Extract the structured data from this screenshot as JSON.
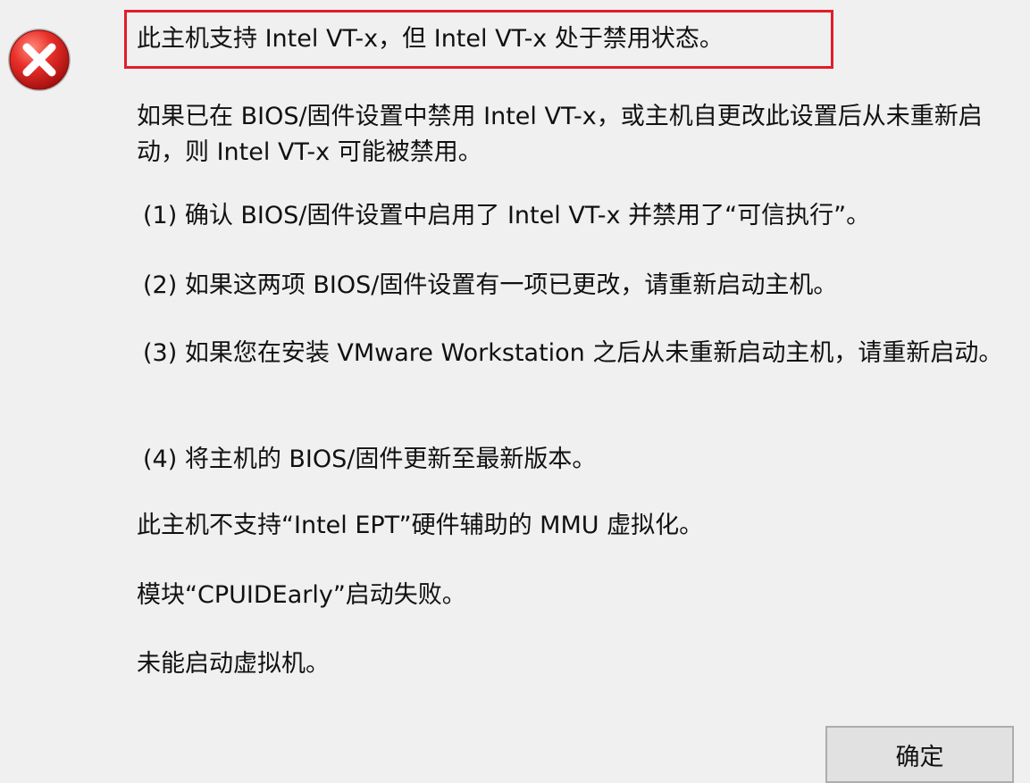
{
  "dialog": {
    "icon": "error-icon",
    "highlight_color": "#e21d2a",
    "messages": {
      "headline": "此主机支持 Intel VT-x，但 Intel VT-x 处于禁用状态。",
      "explanation": "如果已在 BIOS/固件设置中禁用 Intel VT-x，或主机自更改此设置后从未重新启动，则 Intel VT-x 可能被禁用。",
      "step1": "(1) 确认 BIOS/固件设置中启用了 Intel VT-x 并禁用了“可信执行”。",
      "step2": "(2) 如果这两项 BIOS/固件设置有一项已更改，请重新启动主机。",
      "step3": "(3) 如果您在安装 VMware Workstation 之后从未重新启动主机，请重新启动。",
      "step4": "(4) 将主机的 BIOS/固件更新至最新版本。",
      "ept": "此主机不支持“Intel EPT”硬件辅助的 MMU 虚拟化。",
      "module": "模块“CPUIDEarly”启动失败。",
      "failed": "未能启动虚拟机。"
    },
    "ok_label": "确定"
  }
}
